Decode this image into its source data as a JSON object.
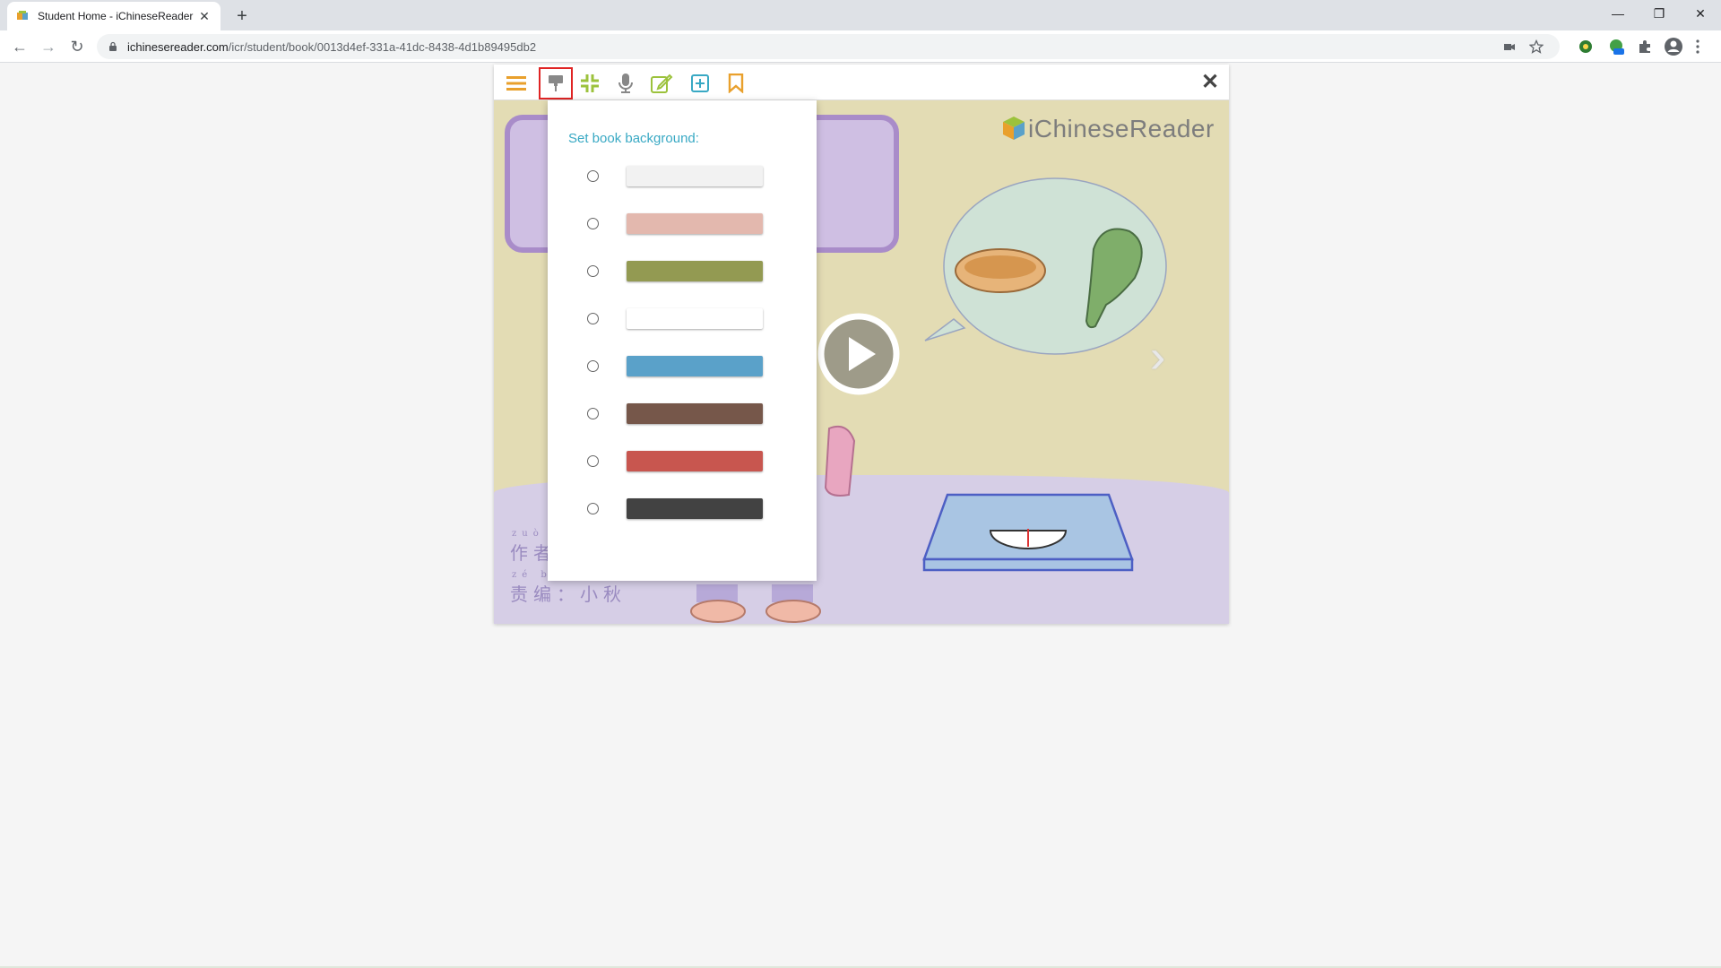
{
  "browser": {
    "tab_title": "Student Home - iChineseReader",
    "tab_close": "✕",
    "new_tab": "+",
    "window_controls": {
      "minimize": "—",
      "restore": "❐",
      "close": "✕"
    },
    "nav": {
      "back": "←",
      "forward": "→",
      "reload": "↻"
    },
    "url_host": "ichinesereader.com",
    "url_path": "/icr/student/book/0013d4ef-331a-41dc-8438-4d1b89495db2"
  },
  "reader": {
    "toolbar": {
      "icons": [
        "menu-icon",
        "paint-roller-icon",
        "compress-icon",
        "microphone-icon",
        "edit-icon",
        "plus-square-icon",
        "bookmark-icon"
      ],
      "close": "✕"
    },
    "logo": "iChineseReader",
    "next_arrow": "›",
    "credits": {
      "pinyin_1": "zuò zhě",
      "line_1": "作者",
      "pinyin_2": "zé biān",
      "line_2": "责编：小秋"
    }
  },
  "popup": {
    "heading": "Set book background:",
    "options": [
      {
        "color": "#f2f2f2"
      },
      {
        "color": "#e3b8ae"
      },
      {
        "color": "#939a52"
      },
      {
        "color": "#ffffff"
      },
      {
        "color": "#5aa1c9"
      },
      {
        "color": "#76574a"
      },
      {
        "color": "#c8564f"
      },
      {
        "color": "#424242"
      }
    ]
  },
  "colors": {
    "accent_orange": "#e9a02c",
    "accent_green": "#9cc23c",
    "accent_teal": "#39a9c4",
    "active_outline": "#e02424"
  }
}
